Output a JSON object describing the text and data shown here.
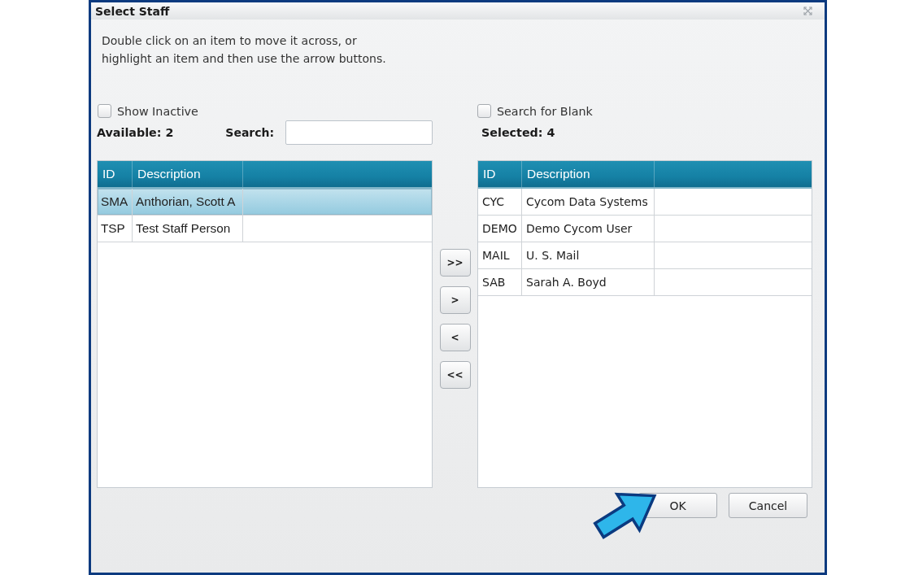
{
  "window": {
    "title": "Select Staff"
  },
  "instructions": [
    "Double click on an item to move it across, or",
    "highlight an item and then use the arrow buttons."
  ],
  "available": {
    "show_inactive": {
      "label": "Show Inactive",
      "checked": false
    },
    "count": "Available: 2",
    "search": {
      "label": "Search:"
    },
    "columns": [
      "ID",
      "Description"
    ],
    "rows": [
      {
        "id": "SMA",
        "description": "Anthorian, Scott A",
        "selected": true
      },
      {
        "id": "TSP",
        "description": "Test Staff Person",
        "selected": false
      }
    ]
  },
  "move_buttons": [
    ">>",
    ">",
    "<",
    "<<"
  ],
  "selected": {
    "search_for_blank": {
      "label": "Search for Blank",
      "checked": false
    },
    "count": "Selected: 4",
    "columns": [
      "ID",
      "Description"
    ],
    "rows": [
      {
        "id": "CYC",
        "description": "Cycom Data Systems",
        "selected": false
      },
      {
        "id": "DEMO",
        "description": "Demo Cycom User",
        "selected": false
      },
      {
        "id": "MAIL",
        "description": "U. S. Mail",
        "selected": false
      },
      {
        "id": "SAB",
        "description": "Sarah A. Boyd",
        "selected": false
      }
    ]
  },
  "buttons": [
    "OK",
    "Cancel"
  ]
}
